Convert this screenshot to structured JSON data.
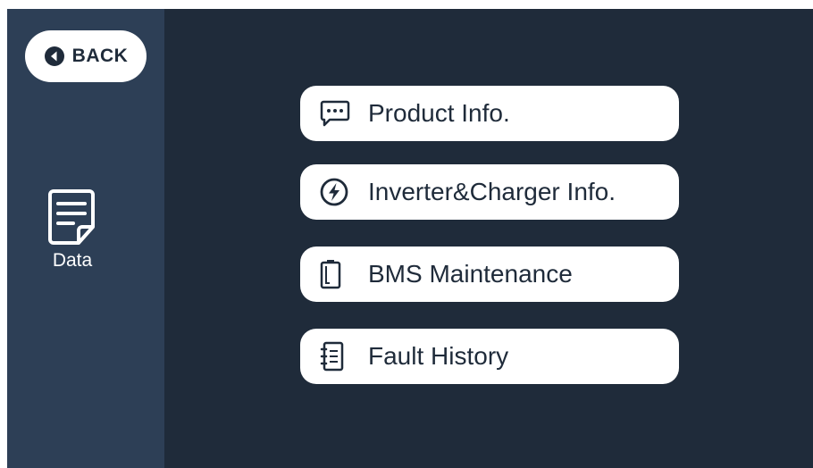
{
  "header": {
    "back_label": "BACK",
    "back_icon": "back-arrow-circle-icon"
  },
  "sidebar": {
    "active_item": {
      "label": "Data",
      "icon": "document-icon"
    }
  },
  "menu": {
    "items": [
      {
        "label": "Product Info.",
        "icon": "message-dots-icon"
      },
      {
        "label": "Inverter&Charger Info.",
        "icon": "lightning-bolt-icon"
      },
      {
        "label": "BMS Maintenance",
        "icon": "battery-icon"
      },
      {
        "label": "Fault History",
        "icon": "notebook-list-icon"
      }
    ]
  },
  "colors": {
    "background": "#1f2b3a",
    "sidebar": "#2d3f56",
    "button": "#ffffff",
    "text_dark": "#1f2b3a"
  }
}
